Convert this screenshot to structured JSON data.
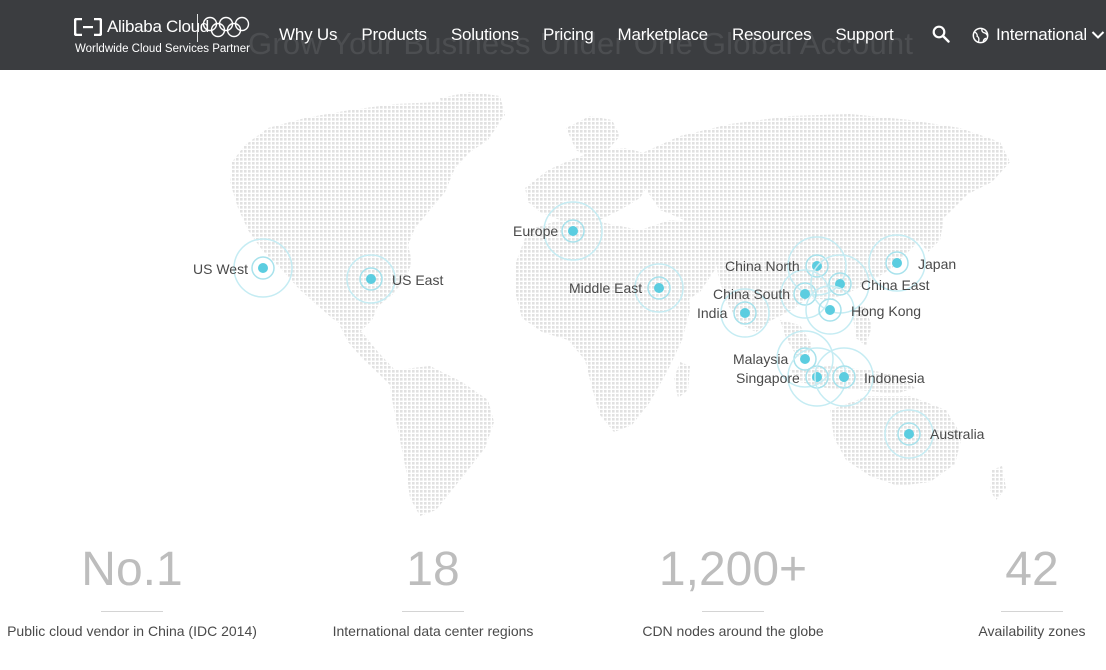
{
  "header": {
    "ghost_title": "Grow Your Business Under One Global Account",
    "logo": {
      "brand": "Alibaba Cloud",
      "tagline": "Worldwide Cloud Services Partner"
    },
    "nav": [
      "Why Us",
      "Products",
      "Solutions",
      "Pricing",
      "Marketplace",
      "Resources",
      "Support"
    ],
    "search_icon": "search-icon",
    "language": {
      "icon": "globe-icon",
      "label": "International"
    }
  },
  "map": {
    "accent_color": "#5bcde0",
    "regions": [
      {
        "name": "US West"
      },
      {
        "name": "US East"
      },
      {
        "name": "Europe"
      },
      {
        "name": "Middle East"
      },
      {
        "name": "India"
      },
      {
        "name": "China North"
      },
      {
        "name": "China South"
      },
      {
        "name": "China East"
      },
      {
        "name": "Hong Kong"
      },
      {
        "name": "Japan"
      },
      {
        "name": "Malaysia"
      },
      {
        "name": "Singapore"
      },
      {
        "name": "Indonesia"
      },
      {
        "name": "Australia"
      }
    ]
  },
  "stats": [
    {
      "value": "No.1",
      "label": "Public cloud vendor in China (IDC 2014)"
    },
    {
      "value": "18",
      "label": "International data center regions"
    },
    {
      "value": "1,200+",
      "label": "CDN nodes around the globe"
    },
    {
      "value": "42",
      "label": "Availability zones"
    }
  ]
}
